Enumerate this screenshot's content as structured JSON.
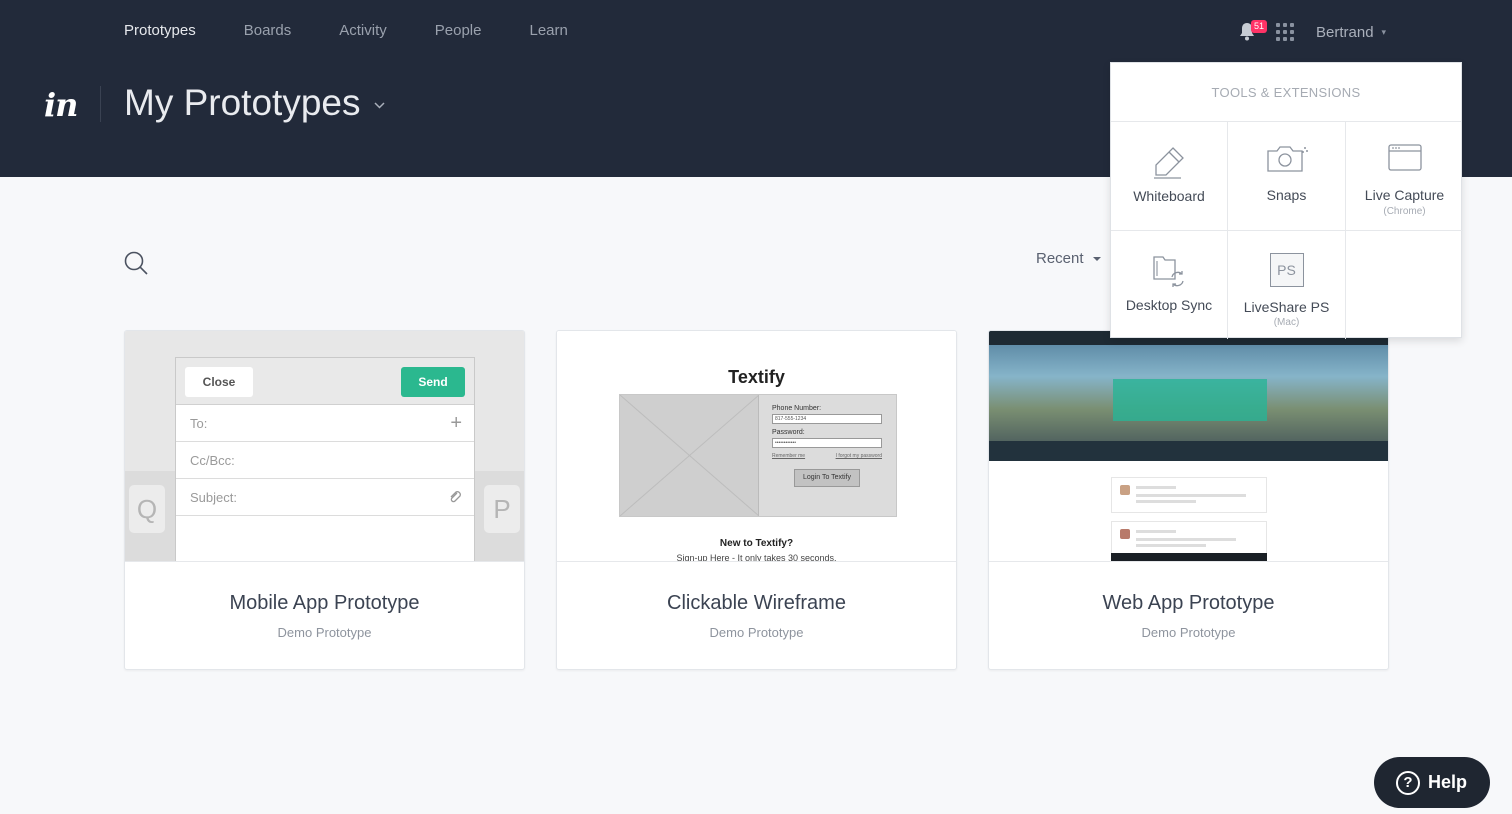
{
  "nav": {
    "items": [
      "Prototypes",
      "Boards",
      "Activity",
      "People",
      "Learn"
    ],
    "active": "Prototypes"
  },
  "header": {
    "notifications_count": "51",
    "user_name": "Bertrand",
    "logo_text": "in",
    "page_title": "My Prototypes"
  },
  "toolbar": {
    "sort_label": "Recent"
  },
  "cards": [
    {
      "title": "Mobile App Prototype",
      "subtitle": "Demo Prototype"
    },
    {
      "title": "Clickable Wireframe",
      "subtitle": "Demo Prototype"
    },
    {
      "title": "Web App Prototype",
      "subtitle": "Demo Prototype"
    }
  ],
  "thumb_mobile": {
    "close": "Close",
    "send": "Send",
    "to": "To:",
    "cc": "Cc/Bcc:",
    "subject": "Subject:",
    "key_left": "Q",
    "key_right": "P"
  },
  "thumb_wireframe": {
    "title": "Textify",
    "phone_label": "Phone Number:",
    "phone_value": "817-555-1234",
    "password_label": "Password:",
    "password_value": "••••••••••••",
    "remember": "Remember me",
    "forgot": "I forgot my password",
    "login": "Login To Textify",
    "new_to": "New to Textify?",
    "signup": "Sign-up Here - It only takes 30 seconds."
  },
  "dropdown": {
    "heading": "TOOLS & EXTENSIONS",
    "tools": [
      {
        "label": "Whiteboard",
        "sub": ""
      },
      {
        "label": "Snaps",
        "sub": ""
      },
      {
        "label": "Live Capture",
        "sub": "(Chrome)"
      },
      {
        "label": "Desktop Sync",
        "sub": ""
      },
      {
        "label": "LiveShare PS",
        "sub": "(Mac)",
        "icon_text": "PS"
      }
    ]
  },
  "help": {
    "label": "Help",
    "icon": "?"
  },
  "colors": {
    "header_bg": "#222a3a",
    "accent_green": "#2bb88f",
    "badge": "#ff3366"
  }
}
